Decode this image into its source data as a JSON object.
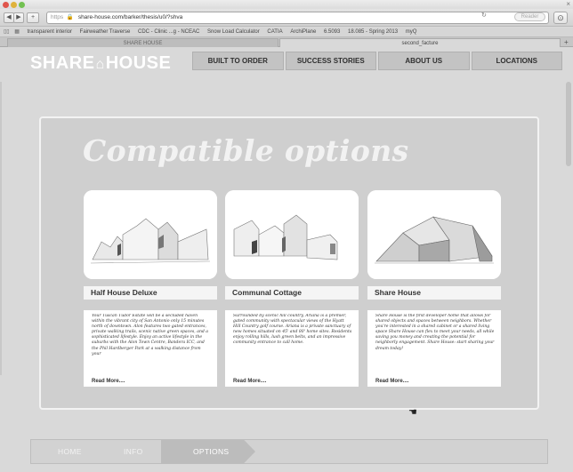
{
  "browser": {
    "url_protocol": "https",
    "url": "share-house.com/barker/thesis/u0/?shva",
    "reader_label": "Reader",
    "bookmarks": [
      "transparent interior",
      "Fairweather Traverse",
      "CDC - Clinic ...g - NCEAC",
      "Snow Load Calculator",
      "CATIA",
      "ArchiPlane",
      "6.5093",
      "18.085 - Spring 2013",
      "myQ"
    ],
    "tabs": [
      "SHARE HOUSE",
      "second_facture"
    ],
    "icons": {
      "back": "chevron-left-icon",
      "forward": "chevron-right-icon",
      "add": "plus-icon",
      "lock": "lock-icon",
      "reload": "reload-icon",
      "downloads": "download-icon",
      "bookmarks": "book-icon",
      "grid": "grid-icon"
    }
  },
  "site": {
    "logo": {
      "left": "SHARE",
      "right": "HOUSE"
    },
    "nav": [
      "BUILT TO ORDER",
      "SUCCESS STORIES",
      "ABOUT US",
      "LOCATIONS"
    ]
  },
  "main": {
    "title": "Compatible options",
    "cards": [
      {
        "title": "Half House Deluxe",
        "description": "Your Tuscan Tudor Estate will be a secluded haven within the vibrant city of San Antonio only 15 minutes north of downtown. Alon features two gated entrances, private walking trails, scenic native green spaces, and a sophisticated lifestyle. Enjoy an active lifestyle in the suburbs with the Alon Town Centre, Bandera ICC, and the Phil Hardberger Park at a walking distance from your",
        "read_more": "Read More...."
      },
      {
        "title": "Communal Cottage",
        "description": "Surrounded by scenic hill country, Ariana is a premier, gated community with spectacular views of the Hyatt Hill Country golf course. Ariana is a private sanctuary of new homes situated on 45' and 80' home sites. Residents enjoy rolling hills, lush green belts, and an impressive community entrance to call home.",
        "read_more": "Read More...."
      },
      {
        "title": "Share House",
        "description": "Share House is the first developer home that allows for shared objects and spaces between neighbors. Whether you're interested in a shared cabinet or a shared living space Share House can flex to meet your needs, all while saving you money and creating the potential for neighborly engagement. Share House: start sharing your dream today!",
        "read_more": "Read More...."
      }
    ]
  },
  "steps": [
    "HOME",
    "INFO",
    "OPTIONS"
  ],
  "active_step": "OPTIONS"
}
